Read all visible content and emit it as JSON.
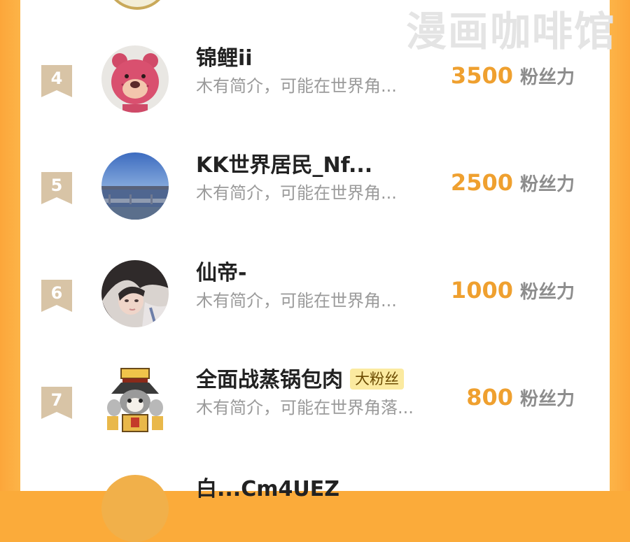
{
  "watermark": "漫画咖啡馆",
  "colors": {
    "accent": "#efa02f",
    "frame": "#fcb347",
    "badge": "#d8c4a6",
    "tag_bg": "#fbeaa0"
  },
  "rows": [
    {
      "rank": "4",
      "name": "锦鲤ii",
      "tag": "",
      "desc": "木有简介，可能在世界角...",
      "score": "3500",
      "unit": "粉丝力",
      "avatar": "strawberry-bear-avatar"
    },
    {
      "rank": "5",
      "name": "KK世界居民_Nf...",
      "tag": "",
      "desc": "木有简介，可能在世界角...",
      "score": "2500",
      "unit": "粉丝力",
      "avatar": "sky-water-avatar"
    },
    {
      "rank": "6",
      "name": "仙帝-",
      "tag": "",
      "desc": "木有简介，可能在世界角...",
      "score": "1000",
      "unit": "粉丝力",
      "avatar": "girl-photo-avatar"
    },
    {
      "rank": "7",
      "name": "全面战蒸锅包肉",
      "tag": "大粉丝",
      "desc": "木有简介，可能在世界角落...",
      "score": "800",
      "unit": "粉丝力",
      "avatar": "cartoon-warrior-avatar"
    }
  ],
  "partial_row": {
    "name": "白...Cm4UEZ"
  }
}
